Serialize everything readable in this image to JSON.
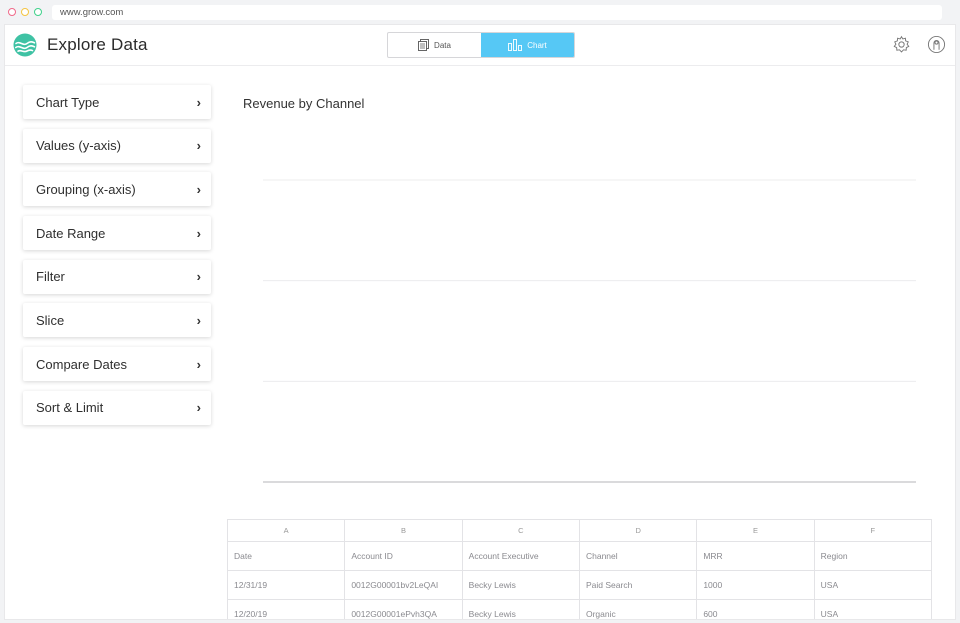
{
  "browser": {
    "url": "www.grow.com"
  },
  "header": {
    "title": "Explore Data",
    "tabs": [
      {
        "label": "Data",
        "icon": "document-icon",
        "active": false
      },
      {
        "label": "Chart",
        "icon": "bar-chart-icon",
        "active": true
      }
    ],
    "accent_color": "#56c8f5"
  },
  "sidebar": {
    "items": [
      {
        "label": "Chart Type"
      },
      {
        "label": "Values (y-axis)"
      },
      {
        "label": "Grouping (x-axis)"
      },
      {
        "label": "Date Range"
      },
      {
        "label": "Filter"
      },
      {
        "label": "Slice"
      },
      {
        "label": "Compare Dates"
      },
      {
        "label": "Sort & Limit"
      }
    ]
  },
  "chart": {
    "title": "Revenue by Channel",
    "gridlines": 4
  },
  "table": {
    "column_letters": [
      "A",
      "B",
      "C",
      "D",
      "E",
      "F"
    ],
    "headers": [
      "Date",
      "Account ID",
      "Account Executive",
      "Channel",
      "MRR",
      "Region"
    ],
    "rows": [
      [
        "12/31/19",
        "0012G00001bv2LeQAI",
        "Becky Lewis",
        "Paid Search",
        "1000",
        "USA"
      ],
      [
        "12/20/19",
        "0012G00001ePvh3QA",
        "Becky Lewis",
        "Organic",
        "600",
        "USA"
      ]
    ]
  }
}
